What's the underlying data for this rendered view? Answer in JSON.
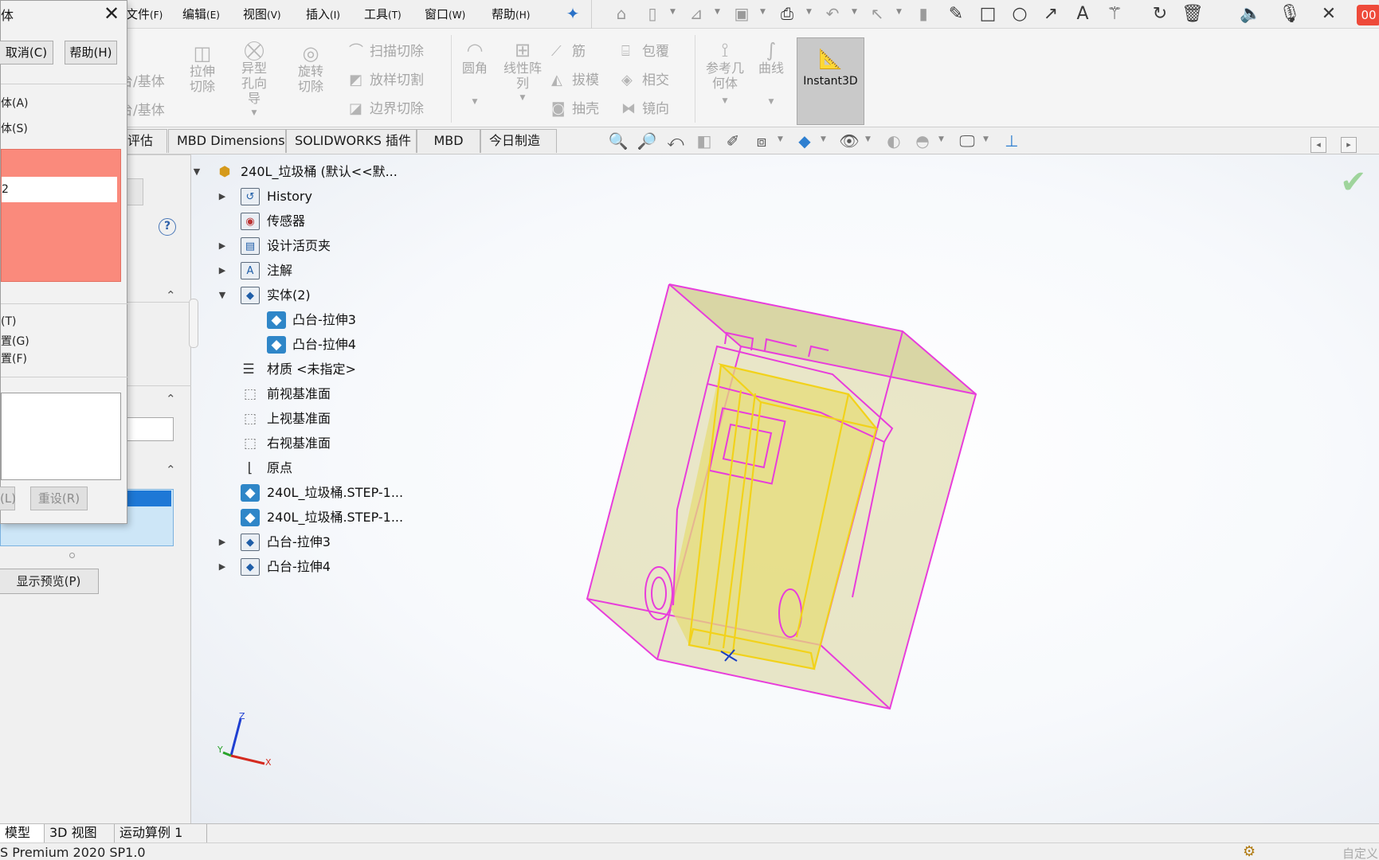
{
  "menubar": {
    "items": [
      {
        "label": "文件",
        "key": "(F)"
      },
      {
        "label": "编辑",
        "key": "(E)"
      },
      {
        "label": "视图",
        "key": "(V)"
      },
      {
        "label": "插入",
        "key": "(I)"
      },
      {
        "label": "工具",
        "key": "(T)"
      },
      {
        "label": "窗口",
        "key": "(W)"
      },
      {
        "label": "帮助",
        "key": "(H)"
      }
    ],
    "record_badge": "00"
  },
  "dialog": {
    "title": "体",
    "cancel_label": "取消(C)",
    "help_label": "帮助(H)",
    "options": [
      "体(A)",
      "体(S)"
    ],
    "selection_item_1": "",
    "selection_item_2": "2",
    "lower_options": [
      "(T)",
      "置(G)",
      "置(F)"
    ],
    "button_apply": "(L)",
    "button_reset": "重设(R)"
  },
  "ribbon": {
    "left_labels": [
      "台/基体",
      "台/基体"
    ],
    "big": [
      {
        "label": "拉伸切除",
        "icon": "extrude-cut-icon"
      },
      {
        "label": "异型孔向导",
        "icon": "hole-wizard-icon"
      },
      {
        "label": "旋转切除",
        "icon": "revolve-cut-icon"
      }
    ],
    "small_col1": [
      "扫描切除",
      "放样切割",
      "边界切除"
    ],
    "big2": [
      {
        "label": "圆角",
        "icon": "fillet-icon"
      },
      {
        "label": "线性阵列",
        "icon": "linear-pattern-icon"
      }
    ],
    "small_col2": [
      "筋",
      "拔模",
      "抽壳"
    ],
    "small_col3": [
      "包覆",
      "相交",
      "镜向"
    ],
    "big3": [
      {
        "label": "参考几何体",
        "icon": "reference-geometry-icon"
      },
      {
        "label": "曲线",
        "icon": "curves-icon"
      }
    ],
    "instant3d": "Instant3D"
  },
  "tabs": [
    "评估",
    "MBD Dimensions",
    "SOLIDWORKS 插件",
    "MBD",
    "今日制造"
  ],
  "tree": {
    "root": "240L_垃圾桶  (默认<<默...",
    "history": "History",
    "sensors": "传感器",
    "design_binder": "设计活页夹",
    "annotations": "注解",
    "solid_bodies": "实体(2)",
    "body_1": "凸台-拉伸3",
    "body_2": "凸台-拉伸4",
    "material": "材质 <未指定>",
    "front_plane": "前视基准面",
    "top_plane": "上视基准面",
    "right_plane": "右视基准面",
    "origin": "原点",
    "step_1": "240L_垃圾桶.STEP-1...",
    "step_2": "240L_垃圾桶.STEP-1...",
    "feature_1": "凸台-拉伸3",
    "feature_2": "凸台-拉伸4"
  },
  "preview_button": "显示预览(P)",
  "bottom_tabs": [
    "模型",
    "3D 视图",
    "运动算例 1"
  ],
  "status": {
    "product": "S Premium 2020 SP1.0",
    "custom": "自定义"
  },
  "triad": {
    "z": "Z",
    "x": "X",
    "y": "Y"
  },
  "colors": {
    "selection_red": "#fa8a7c",
    "model_face": "#d8d49a",
    "edge_magenta": "#e83ddb",
    "edge_yellow": "#f2d21a",
    "selection_blue": "#1e78d6"
  }
}
